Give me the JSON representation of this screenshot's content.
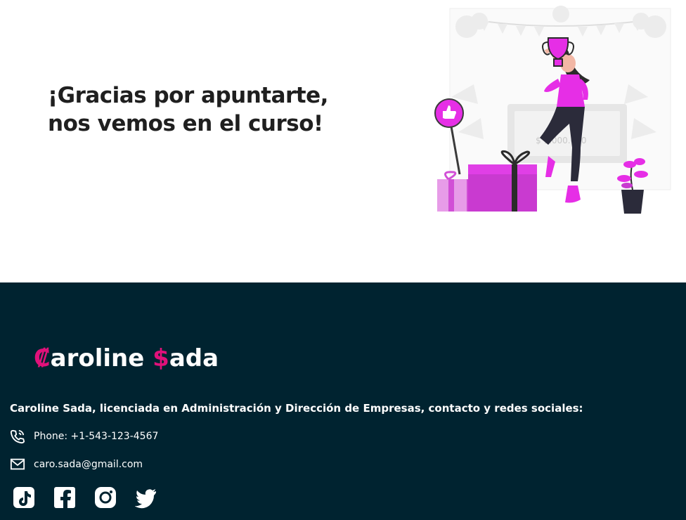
{
  "hero": {
    "headline_line1": "¡Gracias por apuntarte,",
    "headline_line2": "nos vemos en el curso!",
    "illustration_text": "$ 1.000.000"
  },
  "footer": {
    "brand": {
      "first_initial": "₡",
      "first_rest": "aroline ",
      "last_initial": "$",
      "last_rest": "ada"
    },
    "bio": "Caroline Sada, licenciada en Administración y Dirección de Empresas, contacto y redes sociales:",
    "phone": "Phone: +1-543-123-4567",
    "email": "caro.sada@gmail.com",
    "socials": [
      "tiktok-icon",
      "facebook-icon",
      "instagram-icon",
      "twitter-icon"
    ]
  },
  "colors": {
    "footer_bg": "#002330",
    "accent": "#e0117a",
    "illustration_accent": "#e62ee6"
  }
}
